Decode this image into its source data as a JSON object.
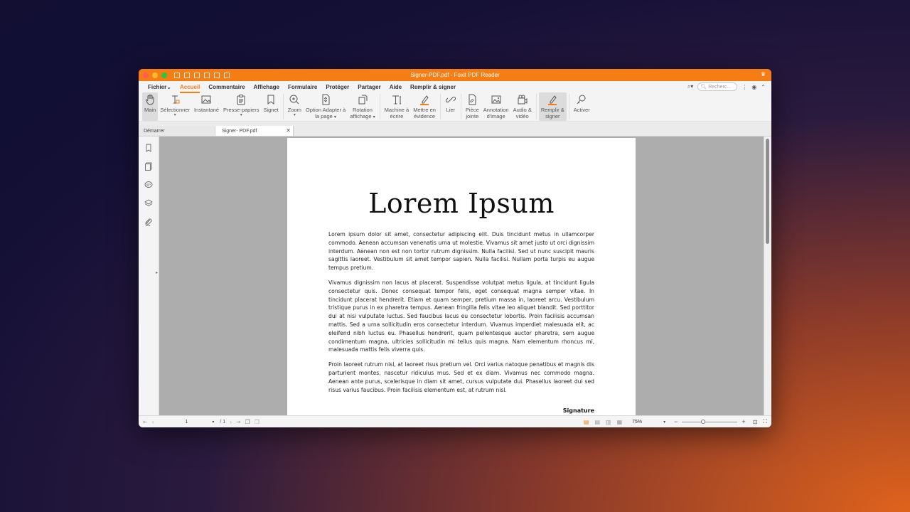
{
  "window": {
    "title": "Signer-PDF.pdf - Foxit PDF Reader"
  },
  "menu": {
    "items": [
      "Fichier",
      "Accueil",
      "Commentaire",
      "Affichage",
      "Formulaire",
      "Protéger",
      "Partager",
      "Aide",
      "Remplir & signer"
    ],
    "active": "Accueil",
    "search_placeholder": "Recherc..."
  },
  "ribbon": {
    "buttons": [
      {
        "label": "Main",
        "icon": "hand-icon"
      },
      {
        "label": "Sélectionner",
        "icon": "text-select-icon"
      },
      {
        "label": "Instantané",
        "icon": "snapshot-icon"
      },
      {
        "label": "Presse-papiers",
        "icon": "clipboard-icon"
      },
      {
        "label": "Signet",
        "icon": "bookmark-icon"
      },
      {
        "label": "Zoom",
        "icon": "zoom-icon"
      },
      {
        "label1": "Option Adapter à",
        "label2": "la page",
        "icon": "fit-page-icon"
      },
      {
        "label1": "Rotation",
        "label2": "affichage",
        "icon": "rotate-icon"
      },
      {
        "label1": "Machine à",
        "label2": "écrire",
        "icon": "typewriter-icon"
      },
      {
        "label1": "Mettre en",
        "label2": "évidence",
        "icon": "highlight-icon"
      },
      {
        "label": "Lier",
        "icon": "link-icon"
      },
      {
        "label1": "Pièce",
        "label2": "jointe",
        "icon": "attachment-icon"
      },
      {
        "label1": "Annotation",
        "label2": "d'image",
        "icon": "image-annotation-icon"
      },
      {
        "label1": "Audio &",
        "label2": "vidéo",
        "icon": "audio-video-icon"
      },
      {
        "label1": "Remplir &",
        "label2": "signer",
        "icon": "fill-sign-icon"
      },
      {
        "label": "Activer",
        "icon": "activate-icon"
      }
    ]
  },
  "tabs": [
    {
      "label": "Démarrer"
    },
    {
      "label": "Signer- PDF.pdf"
    }
  ],
  "document": {
    "title": "Lorem Ipsum",
    "paragraphs": [
      "Lorem ipsum dolor sit amet, consectetur adipiscing elit. Duis tincidunt metus in ullamcorper commodo. Aenean accumsan venenatis urna ut molestie. Vivamus sit amet justo ut orci dignissim interdum. Aenean non est non tortor rutrum dignissim. Nulla facilisi. Sed ut nunc suscipit mauris sagittis laoreet. Vestibulum sit amet tempor sapien. Nulla facilisi. Nullam porta turpis eu augue tempus pretium.",
      "Vivamus dignissim non lacus at placerat. Suspendisse volutpat metus ligula, at tincidunt ligula consectetur quis. Donec consequat tempor felis, eget consequat magna semper vitae. In tincidunt placerat hendrerit. Etiam et quam semper, pretium massa in, laoreet arcu. Vestibulum tristique purus in ex pharetra tempus. Aenean fringilla felis vitae leo aliquet blandit. Sed porttitor dui at nisi vulputate luctus. Sed faucibus lacus eu consectetur lobortis. Proin facilisis accumsan mattis. Sed a urna sollicitudin eros consectetur interdum. Vivamus imperdiet malesuada elit, ac eleifend nibh luctus eu. Phasellus hendrerit, quam pellentesque auctor pharetra, sem augue condimentum magna, ultricies sollicitudin mi tellus quis magna. Nam elementum rhoncus mi, malesuada mattis felis viverra quis.",
      "Proin laoreet rutrum nisl, at laoreet risus pretium vel. Orci varius natoque penatibus et magnis dis parturient montes, nascetur ridiculus mus. Sed et ex diam. Vivamus nec commodo magna. Aenean ante purus, scelerisque in diam sit amet, cursus vulputate dui. Phasellus laoreet dui sed risus varius faucibus. Proin facilisis elementum est, at rutrum nisl."
    ],
    "signature_label": "Signature"
  },
  "status": {
    "page_current": "1",
    "page_total": "/ 1",
    "zoom": "75%",
    "zoom_level_percent": 75
  }
}
